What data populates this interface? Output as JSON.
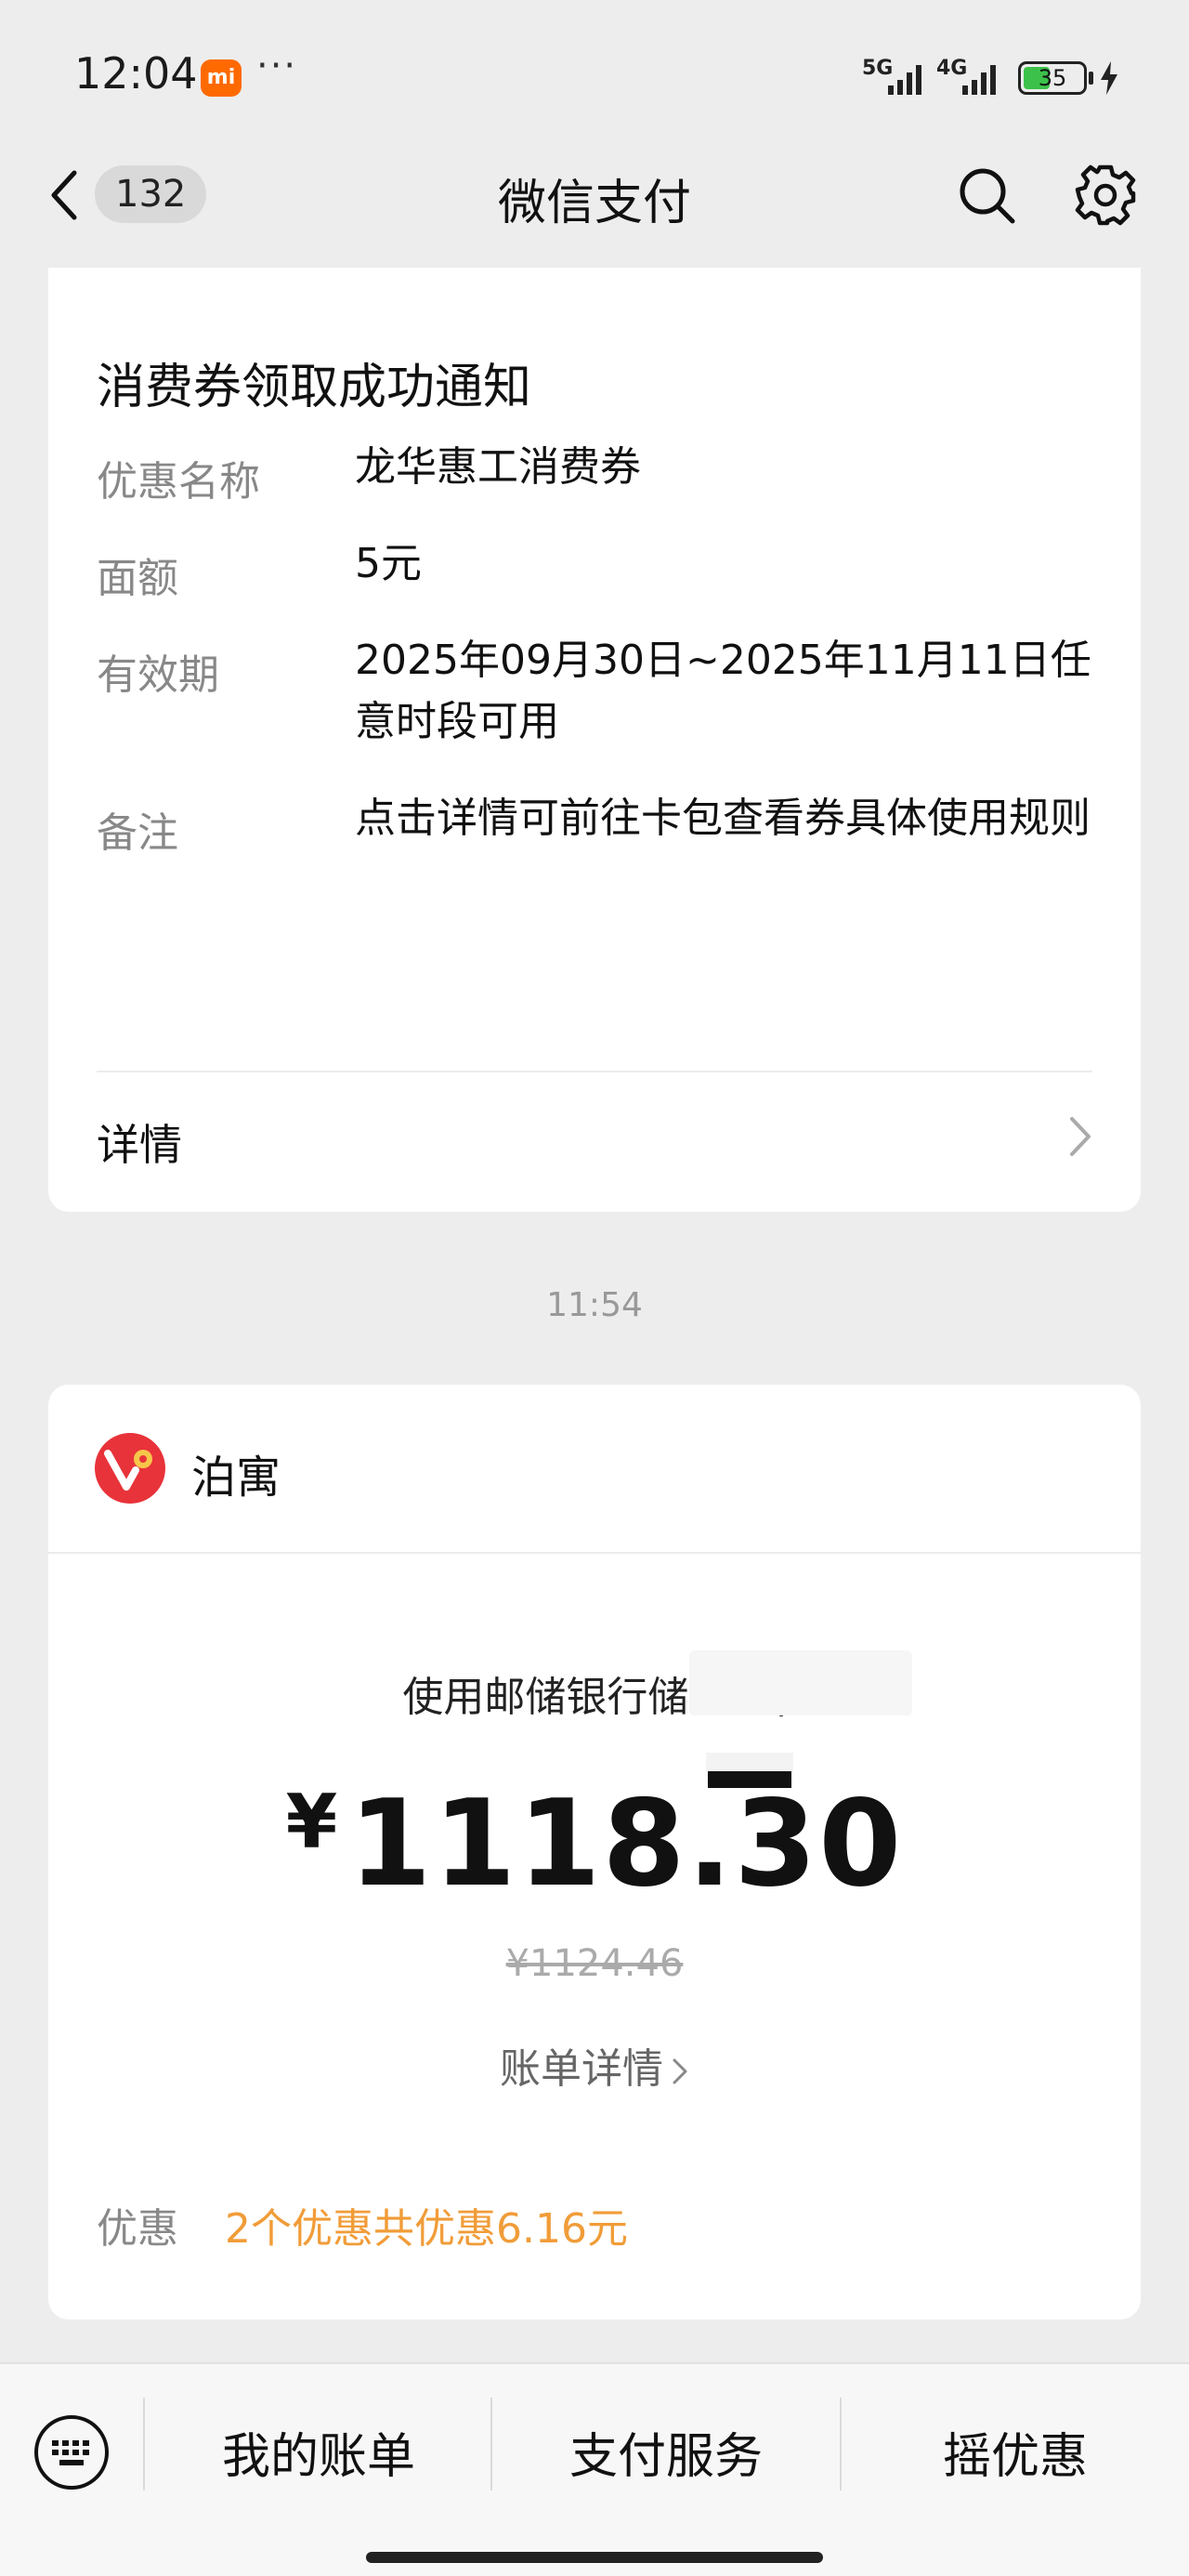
{
  "status_bar": {
    "time": "12:04",
    "mi_badge": "mi",
    "dots": "···",
    "signal_5g": "5G",
    "signal_4g": "4G",
    "battery": "35"
  },
  "nav": {
    "unread_count": "132",
    "title": "微信支付"
  },
  "coupon_card": {
    "title": "消费券领取成功通知",
    "rows": [
      {
        "label": "优惠名称",
        "value": "龙华惠工消费券"
      },
      {
        "label": "面额",
        "value": "5元"
      },
      {
        "label": "有效期",
        "value": "2025年09月30日~2025年11月11日任意时段可用"
      },
      {
        "label": "备注",
        "value": "点击详情可前往卡包查看券具体使用规则"
      }
    ],
    "details_label": "详情"
  },
  "timestamp": "11:54",
  "payment_card": {
    "merchant": "泊寓",
    "pay_method": "使用邮储银行储蓄卡(",
    "currency": "¥",
    "amount": "1118.30",
    "original_price": "¥1124.46",
    "bill_details": "账单详情",
    "discount_label": "优惠",
    "discount_value": "2个优惠共优惠6.16元"
  },
  "bottom_bar": {
    "items": [
      "我的账单",
      "支付服务",
      "摇优惠"
    ]
  },
  "colors": {
    "background": "#ededed",
    "card": "#ffffff",
    "discount": "#f19c38",
    "logo": "#e8333a"
  }
}
